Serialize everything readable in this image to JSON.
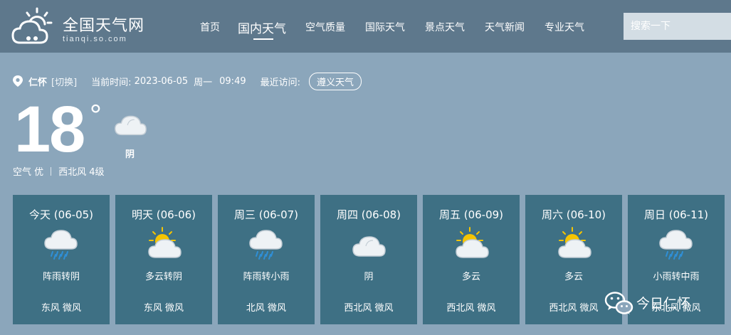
{
  "header": {
    "logo_title": "全国天气网",
    "logo_domain": "tianqi.so.com",
    "nav": [
      {
        "label": "首页"
      },
      {
        "label": "国内天气",
        "active": true
      },
      {
        "label": "空气质量"
      },
      {
        "label": "国际天气"
      },
      {
        "label": "景点天气"
      },
      {
        "label": "天气新闻"
      },
      {
        "label": "专业天气"
      }
    ],
    "search_placeholder": "搜索一下"
  },
  "location": {
    "city": "仁怀",
    "switch_label": "[切换]",
    "time_label": "当前时间:",
    "date": "2023-06-05",
    "weekday": "周一",
    "time": "09:49",
    "recent_label": "最近访问:",
    "recent_link": "遵义天气"
  },
  "current": {
    "temp": "18",
    "deg_symbol": "°",
    "condition": "阴",
    "icon": "cloudy-icon",
    "air": "空气 优",
    "wind": "西北风 4级"
  },
  "forecast": [
    {
      "date": "今天 (06-05)",
      "icon": "rain-icon",
      "condition": "阵雨转阴",
      "wind": "东风 微风"
    },
    {
      "date": "明天 (06-06)",
      "icon": "partly-cloudy-icon",
      "condition": "多云转阴",
      "wind": "东风 微风"
    },
    {
      "date": "周三 (06-07)",
      "icon": "rain-icon",
      "condition": "阵雨转小雨",
      "wind": "北风 微风"
    },
    {
      "date": "周四 (06-08)",
      "icon": "cloudy-icon",
      "condition": "阴",
      "wind": "西北风 微风"
    },
    {
      "date": "周五 (06-09)",
      "icon": "partly-cloudy-icon",
      "condition": "多云",
      "wind": "西北风 微风"
    },
    {
      "date": "周六 (06-10)",
      "icon": "partly-cloudy-icon",
      "condition": "多云",
      "wind": "西北风 微风"
    },
    {
      "date": "周日 (06-11)",
      "icon": "rain-icon",
      "condition": "小雨转中雨",
      "wind": "东北风 微风"
    }
  ],
  "watermark": {
    "text": "今日仁怀",
    "icon": "wechat-icon"
  },
  "colors": {
    "header_bg": "#5e788c",
    "page_bg": "#8ba6bb",
    "card_bg": "#3e7084",
    "sun": "#f5c400"
  }
}
